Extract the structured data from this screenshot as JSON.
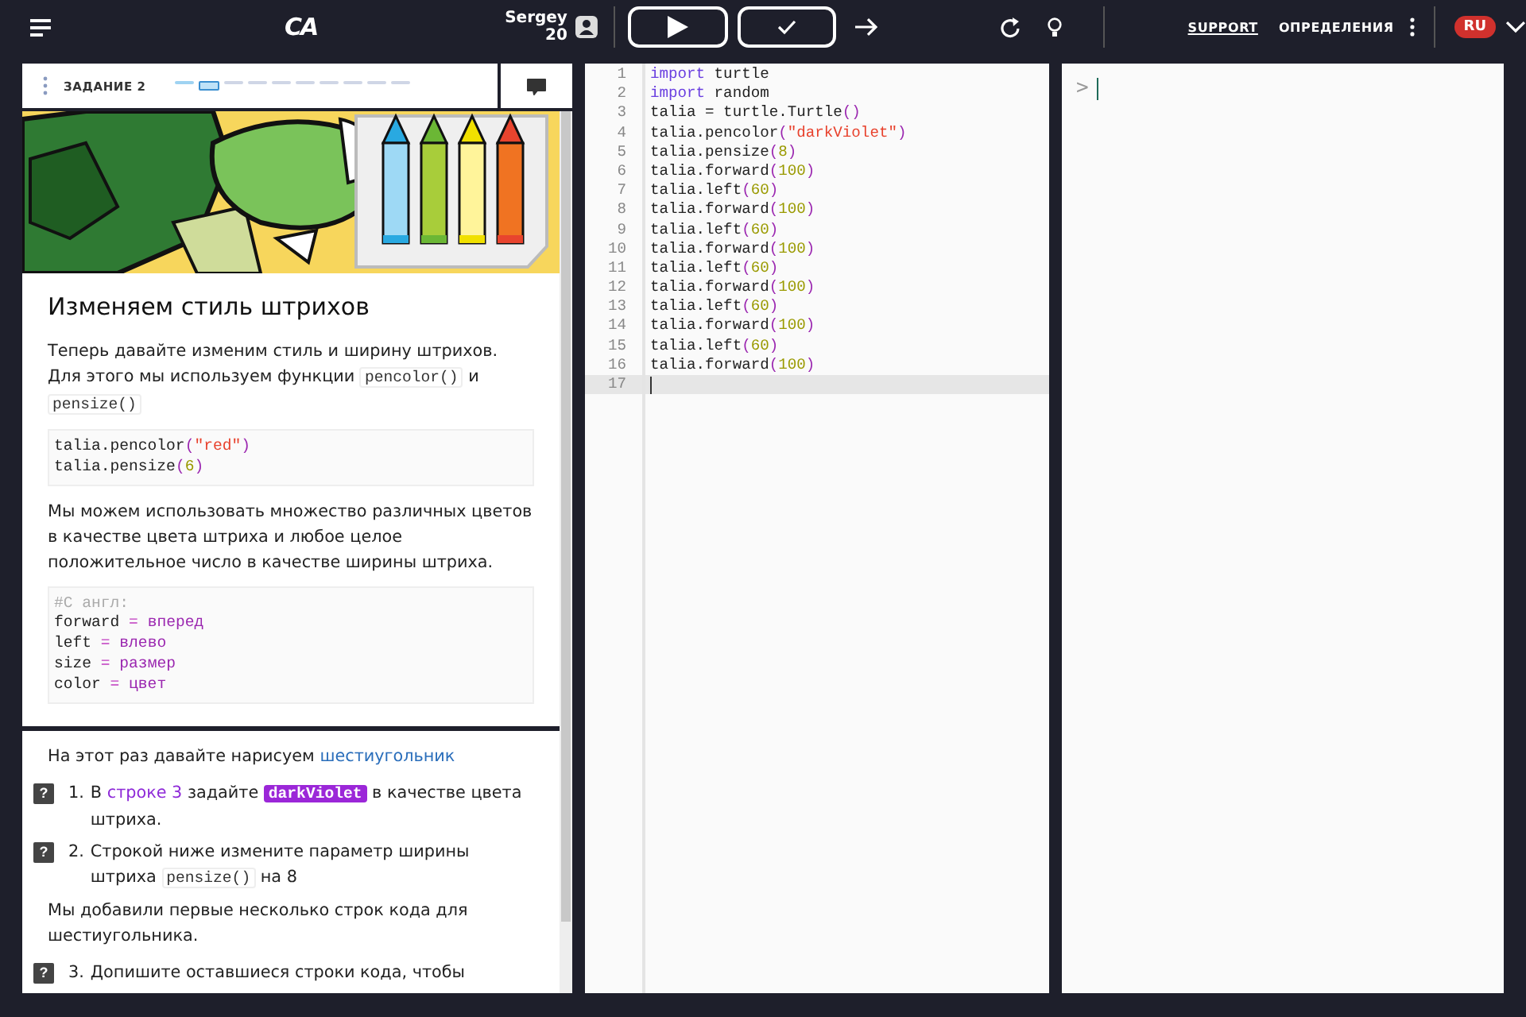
{
  "topbar": {
    "logo": "CA",
    "user": {
      "name": "Sergey",
      "points": "20"
    },
    "links": [
      {
        "label": "SUPPORT",
        "underlined": true
      },
      {
        "label": "ОПРЕДЕЛЕНИЯ",
        "underlined": false
      }
    ],
    "language": "RU"
  },
  "lesson": {
    "title": "ЗАДАНИЕ 2",
    "steps": [
      {
        "done": true,
        "selected": false
      },
      {
        "done": false,
        "selected": true
      },
      {
        "done": false,
        "selected": false
      },
      {
        "done": false,
        "selected": false
      },
      {
        "done": false,
        "selected": false
      },
      {
        "done": false,
        "selected": false
      },
      {
        "done": false,
        "selected": false
      },
      {
        "done": false,
        "selected": false
      },
      {
        "done": false,
        "selected": false
      },
      {
        "done": false,
        "selected": false
      }
    ],
    "heading": "Изменяем стиль штрихов",
    "blocks": [
      {
        "kind": "paragraph",
        "parts": [
          {
            "kind": "text",
            "text": "Теперь давайте изменим стиль и ширину штрихов. Для этого мы используем функции "
          },
          {
            "kind": "code",
            "text": "pencolor()"
          },
          {
            "kind": "text",
            "text": " и "
          },
          {
            "kind": "code",
            "text": "pensize()"
          }
        ]
      },
      {
        "kind": "code",
        "lines": [
          [
            {
              "kind": "plain",
              "text": "talia.pencolor"
            },
            {
              "kind": "paren",
              "text": "("
            },
            {
              "kind": "string",
              "text": "\"red\""
            },
            {
              "kind": "paren",
              "text": ")"
            }
          ],
          [
            {
              "kind": "plain",
              "text": "talia.pensize"
            },
            {
              "kind": "paren",
              "text": "("
            },
            {
              "kind": "number",
              "text": "6"
            },
            {
              "kind": "paren",
              "text": ")"
            }
          ]
        ]
      },
      {
        "kind": "paragraph",
        "parts": [
          {
            "kind": "text",
            "text": "Мы можем использовать множество различных цветов в качестве цвета штриха и любое целое положительное число в качестве ширины штриха."
          }
        ]
      },
      {
        "kind": "code",
        "lines": [
          [
            {
              "kind": "comment",
              "text": "#С англ:"
            }
          ],
          [
            {
              "kind": "plain",
              "text": "forward "
            },
            {
              "kind": "operator",
              "text": "="
            },
            {
              "kind": "word",
              "text": " вперед"
            }
          ],
          [
            {
              "kind": "plain",
              "text": "left "
            },
            {
              "kind": "operator",
              "text": "="
            },
            {
              "kind": "word",
              "text": " влево"
            }
          ],
          [
            {
              "kind": "plain",
              "text": "size "
            },
            {
              "kind": "operator",
              "text": "="
            },
            {
              "kind": "word",
              "text": " размер"
            }
          ],
          [
            {
              "kind": "plain",
              "text": "color "
            },
            {
              "kind": "operator",
              "text": "="
            },
            {
              "kind": "word",
              "text": " цвет"
            }
          ]
        ]
      }
    ],
    "tasks_blocks": [
      {
        "kind": "paragraph",
        "parts": [
          {
            "kind": "text",
            "text": "На этот раз давайте нарисуем "
          },
          {
            "kind": "link",
            "text": "шестиугольник"
          }
        ]
      },
      {
        "kind": "task",
        "help": "?",
        "number": "1.",
        "parts": [
          {
            "kind": "text",
            "text": "В "
          },
          {
            "kind": "ref",
            "text": "строке 3"
          },
          {
            "kind": "text",
            "text": " задайте "
          },
          {
            "kind": "highlight",
            "text": "darkViolet"
          },
          {
            "kind": "text",
            "text": " в качестве цвета штриха."
          }
        ]
      },
      {
        "kind": "task",
        "help": "?",
        "number": "2.",
        "parts": [
          {
            "kind": "text",
            "text": "Строкой ниже измените параметр ширины штриха "
          },
          {
            "kind": "code",
            "text": "pensize()"
          },
          {
            "kind": "text",
            "text": " на 8"
          }
        ]
      },
      {
        "kind": "paragraph",
        "parts": [
          {
            "kind": "text",
            "text": "Мы добавили первые несколько строк кода для шестиугольника."
          }
        ]
      },
      {
        "kind": "task",
        "help": "?",
        "number": "3.",
        "parts": [
          {
            "kind": "text",
            "text": "Допишите оставшиеся строки кода, чтобы"
          }
        ]
      }
    ]
  },
  "editor": {
    "lines": [
      {
        "number": "1",
        "active": false,
        "tokens": [
          {
            "kind": "keyword",
            "text": "import"
          },
          {
            "kind": "plain",
            "text": " turtle"
          }
        ]
      },
      {
        "number": "2",
        "active": false,
        "tokens": [
          {
            "kind": "keyword",
            "text": "import"
          },
          {
            "kind": "plain",
            "text": " random"
          }
        ]
      },
      {
        "number": "3",
        "active": false,
        "tokens": [
          {
            "kind": "plain",
            "text": "talia = turtle.Turtle"
          },
          {
            "kind": "paren",
            "text": "()"
          }
        ]
      },
      {
        "number": "4",
        "active": false,
        "tokens": [
          {
            "kind": "plain",
            "text": "talia.pencolor"
          },
          {
            "kind": "paren",
            "text": "("
          },
          {
            "kind": "string",
            "text": "\"darkViolet\""
          },
          {
            "kind": "paren",
            "text": ")"
          }
        ]
      },
      {
        "number": "5",
        "active": false,
        "tokens": [
          {
            "kind": "plain",
            "text": "talia.pensize"
          },
          {
            "kind": "paren",
            "text": "("
          },
          {
            "kind": "number",
            "text": "8"
          },
          {
            "kind": "paren",
            "text": ")"
          }
        ]
      },
      {
        "number": "6",
        "active": false,
        "tokens": [
          {
            "kind": "plain",
            "text": "talia.forward"
          },
          {
            "kind": "paren",
            "text": "("
          },
          {
            "kind": "number",
            "text": "100"
          },
          {
            "kind": "paren",
            "text": ")"
          }
        ]
      },
      {
        "number": "7",
        "active": false,
        "tokens": [
          {
            "kind": "plain",
            "text": "talia.left"
          },
          {
            "kind": "paren",
            "text": "("
          },
          {
            "kind": "number",
            "text": "60"
          },
          {
            "kind": "paren",
            "text": ")"
          }
        ]
      },
      {
        "number": "8",
        "active": false,
        "tokens": [
          {
            "kind": "plain",
            "text": "talia.forward"
          },
          {
            "kind": "paren",
            "text": "("
          },
          {
            "kind": "number",
            "text": "100"
          },
          {
            "kind": "paren",
            "text": ")"
          }
        ]
      },
      {
        "number": "9",
        "active": false,
        "tokens": [
          {
            "kind": "plain",
            "text": "talia.left"
          },
          {
            "kind": "paren",
            "text": "("
          },
          {
            "kind": "number",
            "text": "60"
          },
          {
            "kind": "paren",
            "text": ")"
          }
        ]
      },
      {
        "number": "10",
        "active": false,
        "tokens": [
          {
            "kind": "plain",
            "text": "talia.forward"
          },
          {
            "kind": "paren",
            "text": "("
          },
          {
            "kind": "number",
            "text": "100"
          },
          {
            "kind": "paren",
            "text": ")"
          }
        ]
      },
      {
        "number": "11",
        "active": false,
        "tokens": [
          {
            "kind": "plain",
            "text": "talia.left"
          },
          {
            "kind": "paren",
            "text": "("
          },
          {
            "kind": "number",
            "text": "60"
          },
          {
            "kind": "paren",
            "text": ")"
          }
        ]
      },
      {
        "number": "12",
        "active": false,
        "tokens": [
          {
            "kind": "plain",
            "text": "talia.forward"
          },
          {
            "kind": "paren",
            "text": "("
          },
          {
            "kind": "number",
            "text": "100"
          },
          {
            "kind": "paren",
            "text": ")"
          }
        ]
      },
      {
        "number": "13",
        "active": false,
        "tokens": [
          {
            "kind": "plain",
            "text": "talia.left"
          },
          {
            "kind": "paren",
            "text": "("
          },
          {
            "kind": "number",
            "text": "60"
          },
          {
            "kind": "paren",
            "text": ")"
          }
        ]
      },
      {
        "number": "14",
        "active": false,
        "tokens": [
          {
            "kind": "plain",
            "text": "talia.forward"
          },
          {
            "kind": "paren",
            "text": "("
          },
          {
            "kind": "number",
            "text": "100"
          },
          {
            "kind": "paren",
            "text": ")"
          }
        ]
      },
      {
        "number": "15",
        "active": false,
        "tokens": [
          {
            "kind": "plain",
            "text": "talia.left"
          },
          {
            "kind": "paren",
            "text": "("
          },
          {
            "kind": "number",
            "text": "60"
          },
          {
            "kind": "paren",
            "text": ")"
          }
        ]
      },
      {
        "number": "16",
        "active": false,
        "tokens": [
          {
            "kind": "plain",
            "text": "talia.forward"
          },
          {
            "kind": "paren",
            "text": "("
          },
          {
            "kind": "number",
            "text": "100"
          },
          {
            "kind": "paren",
            "text": ")"
          }
        ]
      },
      {
        "number": "17",
        "active": true
      }
    ]
  },
  "console": {
    "prompt": ">"
  }
}
